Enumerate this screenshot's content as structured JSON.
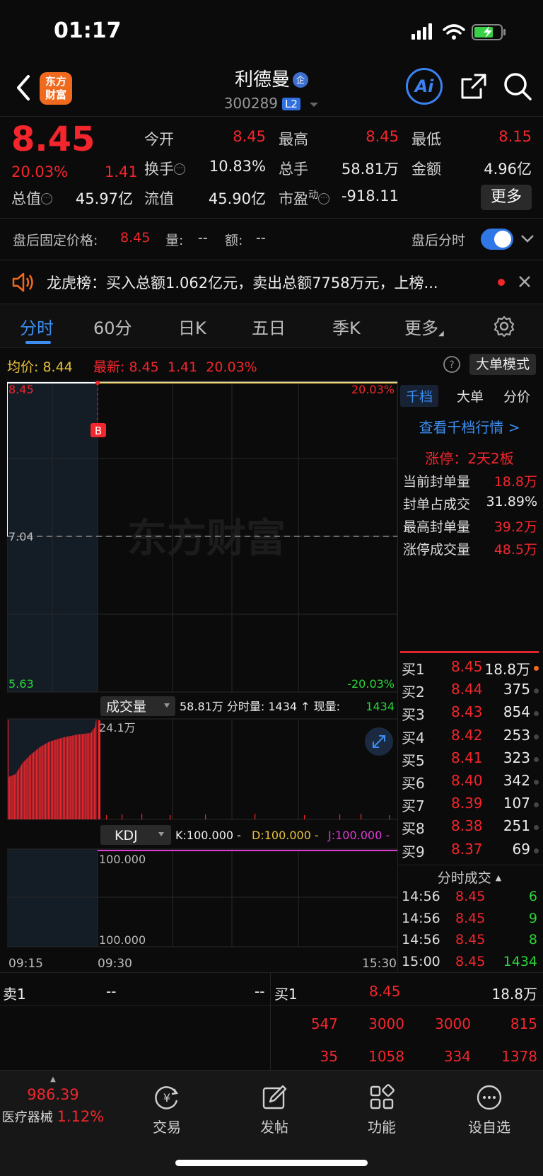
{
  "status": {
    "time": "01:17"
  },
  "header": {
    "logo_text_1": "东方",
    "logo_text_2": "财富",
    "stock_name": "利德曼",
    "badge": "企",
    "code": "300289",
    "level": "L2",
    "ai_label": "Ai"
  },
  "quote": {
    "price": "8.45",
    "pct": "20.03%",
    "change": "1.41",
    "open_label": "今开",
    "open": "8.45",
    "high_label": "最高",
    "high": "8.45",
    "low_label": "最低",
    "low": "8.15",
    "turnover_label": "换手",
    "turnover": "10.83%",
    "vol_label": "总手",
    "vol": "58.81万",
    "amount_label": "金额",
    "amount": "4.96亿",
    "mktcap_label": "总值",
    "mktcap": "45.97亿",
    "float_label": "流值",
    "float": "45.90亿",
    "pe_label": "市盈",
    "pe_sup": "动",
    "pe": "-918.11",
    "more": "更多"
  },
  "after_hours": {
    "label": "盘后固定价格:",
    "price": "8.45",
    "vol_label": "量:",
    "vol": "--",
    "amt_label": "额:",
    "amt": "--",
    "toggle_label": "盘后分时"
  },
  "banner": {
    "text": "龙虎榜：买入总额1.062亿元，卖出总额7758万元，上榜..."
  },
  "tabs": [
    "分时",
    "60分",
    "日K",
    "五日",
    "季K",
    "更多"
  ],
  "avg": {
    "avg_label": "均价:",
    "avg": "8.44",
    "latest_label": "最新:",
    "latest": "8.45",
    "latest_chg": "1.41",
    "latest_pct": "20.03%",
    "big_mode": "大单模式"
  },
  "chart": {
    "top_left": "8.45",
    "top_right": "20.03%",
    "mid_left": "7.04",
    "bot_left": "5.63",
    "bot_right": "-20.03%",
    "watermark": "东方财富",
    "marker": "B",
    "vol_selector": "成交量",
    "vol_info": "58.81万 分时量: 1434 ↑ 现量:",
    "vol_now": "1434",
    "vol_max": "24.1万",
    "kdj_selector": "KDJ",
    "kdj_k": "K:100.000 -",
    "kdj_d": "D:100.000 -",
    "kdj_j": "J:100.000 -",
    "kdj_top": "100.000",
    "kdj_bot": "100.000",
    "x_start": "09:15",
    "x_mid": "09:30",
    "x_end": "15:30"
  },
  "side": {
    "tabs": [
      "千档",
      "大单",
      "分价"
    ],
    "link": "查看千档行情 >",
    "limit_up": "涨停：2天2板",
    "stats": [
      {
        "label": "当前封单量",
        "value": "18.8万"
      },
      {
        "label": "封单占成交",
        "value": "31.89%"
      },
      {
        "label": "最高封单量",
        "value": "39.2万"
      },
      {
        "label": "涨停成交量",
        "value": "48.5万"
      }
    ],
    "bids": [
      {
        "label": "买1",
        "price": "8.45",
        "vol": "18.8万"
      },
      {
        "label": "买2",
        "price": "8.44",
        "vol": "375"
      },
      {
        "label": "买3",
        "price": "8.43",
        "vol": "854"
      },
      {
        "label": "买4",
        "price": "8.42",
        "vol": "253"
      },
      {
        "label": "买5",
        "price": "8.41",
        "vol": "323"
      },
      {
        "label": "买6",
        "price": "8.40",
        "vol": "342"
      },
      {
        "label": "买7",
        "price": "8.39",
        "vol": "107"
      },
      {
        "label": "买8",
        "price": "8.38",
        "vol": "251"
      },
      {
        "label": "买9",
        "price": "8.37",
        "vol": "69"
      }
    ],
    "ticks_title": "分时成交",
    "ticks": [
      {
        "time": "14:56",
        "price": "8.45",
        "vol": "6"
      },
      {
        "time": "14:56",
        "price": "8.45",
        "vol": "9"
      },
      {
        "time": "14:56",
        "price": "8.45",
        "vol": "8"
      },
      {
        "time": "15:00",
        "price": "8.45",
        "vol": "1434"
      }
    ]
  },
  "bottom": {
    "sell_label": "卖1",
    "sell_price": "--",
    "sell_vol": "--",
    "buy_label": "买1",
    "buy_price": "8.45",
    "buy_vol": "18.8万",
    "row1": [
      "547",
      "3000",
      "3000",
      "815"
    ],
    "row2": [
      "35",
      "1058",
      "334",
      "1378"
    ]
  },
  "nav": {
    "index_value": "986.39",
    "index_name": "医疗器械",
    "index_pct": "1.12%",
    "items": [
      "交易",
      "发帖",
      "功能",
      "设自选"
    ]
  },
  "colors": {
    "up": "#f2262c",
    "down": "#2bd43a",
    "accent": "#3b8df0",
    "avg": "#e8c23a"
  }
}
